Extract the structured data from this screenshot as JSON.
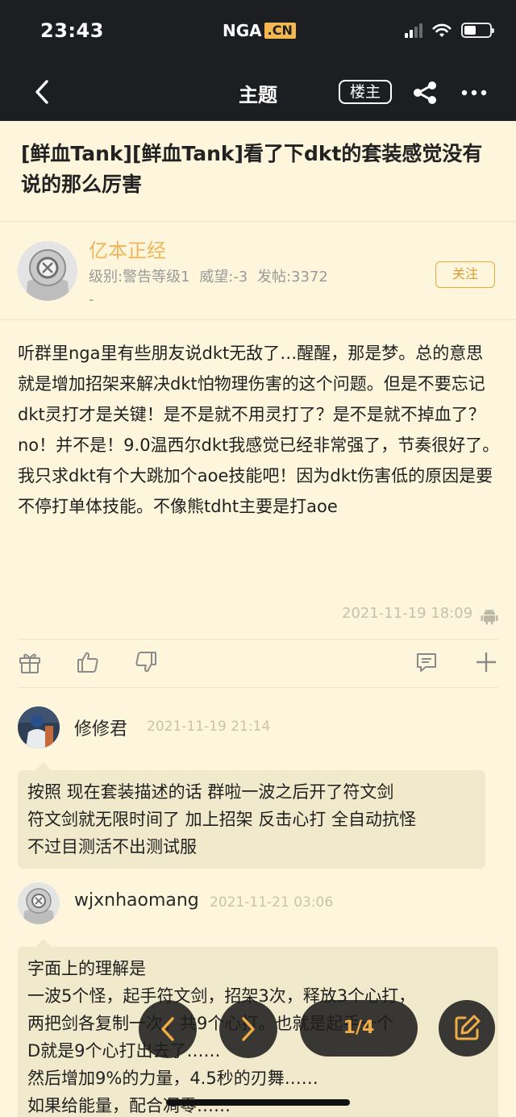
{
  "status_bar": {
    "time": "23:43",
    "logo_text": "NGA",
    "logo_badge": ".CN"
  },
  "navbar": {
    "title": "主题",
    "louzhu_label": "楼主"
  },
  "thread": {
    "title": "[鲜血Tank][鲜血Tank]看了下dkt的套装感觉没有说的那么厉害"
  },
  "author": {
    "name": "亿本正经",
    "meta": "级别:警告等级1 威望:-3 发帖:3372",
    "extra": "-",
    "follow_label": "关注"
  },
  "post": {
    "body": "听群里nga里有些朋友说dkt无敌了…醒醒，那是梦。总的意思就是增加招架来解决dkt怕物理伤害的这个问题。但是不要忘记dkt灵打才是关键！是不是就不用灵打了？是不是就不掉血了？no！并不是！9.0温西尔dkt我感觉已经非常强了，节奏很好了。我只求dkt有个大跳加个aoe技能吧！因为dkt伤害低的原因是要不停打单体技能。不像熊tdht主要是打aoe",
    "time": "2021-11-19 18:09"
  },
  "action_icons": [
    "gift-icon",
    "thumbs-up-icon",
    "thumbs-down-icon",
    "comment-icon",
    "plus-icon"
  ],
  "replies": [
    {
      "name": "修修君",
      "time": "2021-11-19 21:14",
      "lines": [
        "按照 现在套装描述的话 群啦一波之后开了符文剑",
        "符文剑就无限时间了 加上招架 反击心打 全自动抗怪",
        "不过目测活不出测试服"
      ]
    },
    {
      "name": "wjxnhaomang",
      "time": "2021-11-21 03:06",
      "lines": [
        "字面上的理解是",
        "一波5个怪，起手符文剑，招架3次，释放3个心打，",
        "两把剑各复制一次，共9个心打。也就是起手一个",
        "D就是9个心打出去了……",
        "然后增加9%的力量，4.5秒的刃舞……",
        "如果给能量，配合凋零……"
      ]
    }
  ],
  "pager": {
    "label": "1/4"
  }
}
